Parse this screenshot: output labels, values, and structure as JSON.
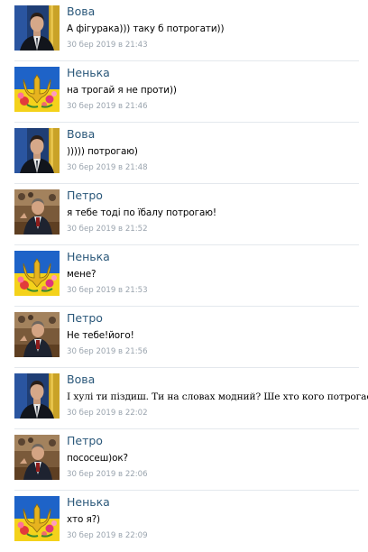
{
  "messages": [
    {
      "author": "Вова",
      "avatar": "vova",
      "text": "А фігурака))) таку б потрогати))",
      "time": "30 бер 2019 в 21:43",
      "serif": false
    },
    {
      "author": "Ненька",
      "avatar": "nenka",
      "text": "на трогай я не проти))",
      "time": "30 бер 2019 в 21:46",
      "serif": false
    },
    {
      "author": "Вова",
      "avatar": "vova",
      "text": "))))) потрогаю)",
      "time": "30 бер 2019 в 21:48",
      "serif": false
    },
    {
      "author": "Петро",
      "avatar": "petro",
      "text": "я тебе тоді по їбалу потрогаю!",
      "time": "30 бер 2019 в 21:52",
      "serif": false
    },
    {
      "author": "Ненька",
      "avatar": "nenka",
      "text": "мене?",
      "time": "30 бер 2019 в 21:53",
      "serif": false
    },
    {
      "author": "Петро",
      "avatar": "petro",
      "text": "Не тебе!його!",
      "time": "30 бер 2019 в 21:56",
      "serif": false
    },
    {
      "author": "Вова",
      "avatar": "vova",
      "text": "І хулі ти піздиш. Ти на словах модний? Ше хто кого потрогає.",
      "time": "30 бер 2019 в 22:02",
      "serif": true
    },
    {
      "author": "Петро",
      "avatar": "petro",
      "text": "пососеш)ок?",
      "time": "30 бер 2019 в 22:06",
      "serif": false
    },
    {
      "author": "Ненька",
      "avatar": "nenka",
      "text": "хто я?)",
      "time": "30 бер 2019 в 22:09",
      "serif": false
    }
  ]
}
